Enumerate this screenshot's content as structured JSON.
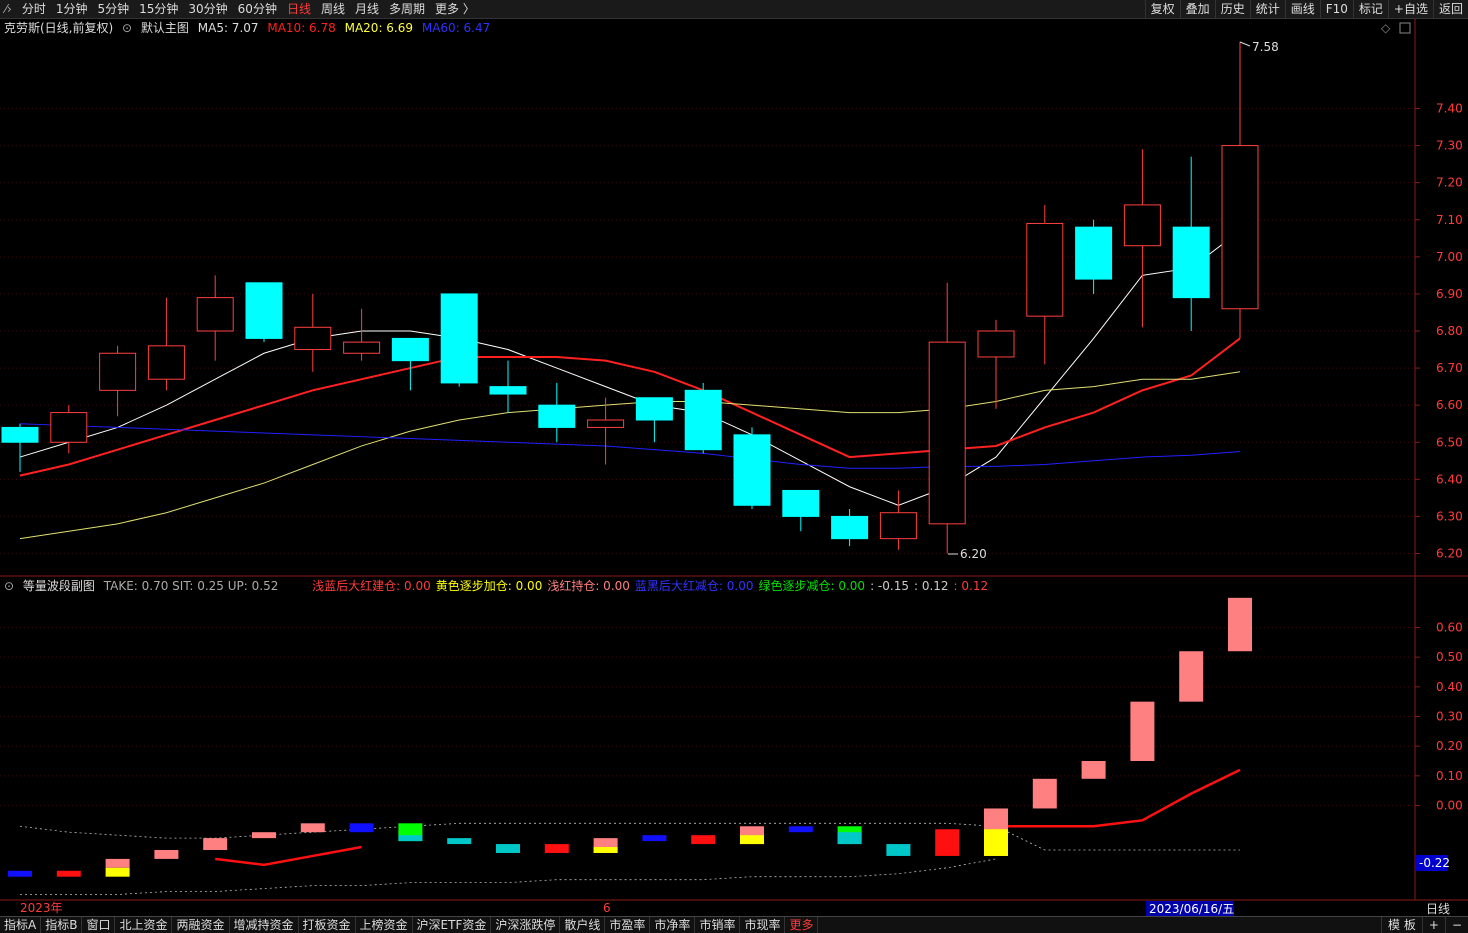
{
  "topbar": {
    "tabs": [
      {
        "label": "分时",
        "active": false
      },
      {
        "label": "1分钟",
        "active": false
      },
      {
        "label": "5分钟",
        "active": false
      },
      {
        "label": "15分钟",
        "active": false
      },
      {
        "label": "30分钟",
        "active": false
      },
      {
        "label": "60分钟",
        "active": false
      },
      {
        "label": "日线",
        "active": true
      },
      {
        "label": "周线",
        "active": false
      },
      {
        "label": "月线",
        "active": false
      },
      {
        "label": "多周期",
        "active": false
      },
      {
        "label": "更多 〉",
        "active": false
      }
    ],
    "right": [
      "复权",
      "叠加",
      "历史",
      "统计",
      "画线",
      "F10",
      "标记",
      "+自选",
      "返回"
    ]
  },
  "main_legend": {
    "stock": "克劳斯(日线,前复权)",
    "template": "默认主图",
    "ma5": "MA5: 7.07",
    "ma10": "MA10: 6.78",
    "ma20": "MA20: 6.69",
    "ma60": "MA60: 6.47"
  },
  "sub_legend": {
    "name": "等量波段副图",
    "params": "TAKE: 0.70  SIT: 0.25  UP: 0.52",
    "items": [
      {
        "text": "浅蓝后大红建仓: 0.00",
        "color": "#ff3b3b"
      },
      {
        "text": "黄色逐步加仓: 0.00",
        "color": "#ffff00"
      },
      {
        "text": "浅红持仓: 0.00",
        "color": "#ff8080"
      },
      {
        "text": "蓝黑后大红减仓: 0.00",
        "color": "#3333ff"
      },
      {
        "text": "绿色逐步减仓: 0.00",
        "color": "#00e000"
      },
      {
        "text": ": -0.15",
        "color": "#cccccc"
      },
      {
        "text": ": 0.12",
        "color": "#cccccc"
      },
      {
        "text": ": 0.12",
        "color": "#ff3b3b"
      }
    ]
  },
  "axis": {
    "price_ticks": [
      "7.40",
      "7.30",
      "7.20",
      "7.10",
      "7.00",
      "6.90",
      "6.80",
      "6.70",
      "6.60",
      "6.50",
      "6.40",
      "6.30",
      "6.20"
    ],
    "sub_ticks": [
      "0.60",
      "0.50",
      "0.40",
      "0.30",
      "0.20",
      "0.10",
      "0.00"
    ],
    "sub_current": "-0.22",
    "high_label": "7.58",
    "low_label": "6.20",
    "date_start": "2023年",
    "date_mid": "6",
    "cursor_date": "2023/06/16/五",
    "period": "日线"
  },
  "colors": {
    "up": "#ff4040",
    "down": "#00ffff",
    "ma5": "#ffffff",
    "ma10": "#ff2020",
    "ma20": "#e0e070",
    "ma60": "#2020ff"
  },
  "chart_data": {
    "type": "candlestick",
    "title": "克劳斯(日线,前复权)",
    "candles": [
      {
        "o": 6.54,
        "h": 6.55,
        "l": 6.42,
        "c": 6.5
      },
      {
        "o": 6.5,
        "h": 6.6,
        "l": 6.47,
        "c": 6.58
      },
      {
        "o": 6.64,
        "h": 6.76,
        "l": 6.57,
        "c": 6.74
      },
      {
        "o": 6.67,
        "h": 6.89,
        "l": 6.64,
        "c": 6.76
      },
      {
        "o": 6.8,
        "h": 6.95,
        "l": 6.72,
        "c": 6.89
      },
      {
        "o": 6.93,
        "h": 6.93,
        "l": 6.77,
        "c": 6.78
      },
      {
        "o": 6.75,
        "h": 6.9,
        "l": 6.69,
        "c": 6.81
      },
      {
        "o": 6.74,
        "h": 6.86,
        "l": 6.72,
        "c": 6.77
      },
      {
        "o": 6.78,
        "h": 6.78,
        "l": 6.64,
        "c": 6.72
      },
      {
        "o": 6.9,
        "h": 6.9,
        "l": 6.65,
        "c": 6.66
      },
      {
        "o": 6.65,
        "h": 6.72,
        "l": 6.58,
        "c": 6.63
      },
      {
        "o": 6.6,
        "h": 6.66,
        "l": 6.5,
        "c": 6.54
      },
      {
        "o": 6.54,
        "h": 6.62,
        "l": 6.44,
        "c": 6.56
      },
      {
        "o": 6.62,
        "h": 6.62,
        "l": 6.5,
        "c": 6.56
      },
      {
        "o": 6.64,
        "h": 6.66,
        "l": 6.47,
        "c": 6.48
      },
      {
        "o": 6.52,
        "h": 6.54,
        "l": 6.32,
        "c": 6.33
      },
      {
        "o": 6.37,
        "h": 6.37,
        "l": 6.26,
        "c": 6.3
      },
      {
        "o": 6.3,
        "h": 6.32,
        "l": 6.22,
        "c": 6.24
      },
      {
        "o": 6.24,
        "h": 6.37,
        "l": 6.21,
        "c": 6.31
      },
      {
        "o": 6.28,
        "h": 6.93,
        "l": 6.2,
        "c": 6.77
      },
      {
        "o": 6.73,
        "h": 6.83,
        "l": 6.59,
        "c": 6.8
      },
      {
        "o": 6.84,
        "h": 7.14,
        "l": 6.71,
        "c": 7.09
      },
      {
        "o": 7.08,
        "h": 7.1,
        "l": 6.9,
        "c": 6.94
      },
      {
        "o": 7.03,
        "h": 7.29,
        "l": 6.81,
        "c": 7.14
      },
      {
        "o": 7.08,
        "h": 7.27,
        "l": 6.8,
        "c": 6.89
      },
      {
        "o": 6.86,
        "h": 7.58,
        "l": 6.78,
        "c": 7.3
      }
    ],
    "ma": {
      "MA5": [
        6.46,
        6.5,
        6.54,
        6.6,
        6.67,
        6.74,
        6.78,
        6.8,
        6.8,
        6.78,
        6.75,
        6.7,
        6.65,
        6.6,
        6.58,
        6.52,
        6.45,
        6.38,
        6.33,
        6.38,
        6.46,
        6.62,
        6.78,
        6.95,
        6.97,
        7.07
      ],
      "MA10": [
        6.41,
        6.44,
        6.48,
        6.52,
        6.56,
        6.6,
        6.64,
        6.67,
        6.7,
        6.73,
        6.73,
        6.73,
        6.72,
        6.69,
        6.64,
        6.58,
        6.52,
        6.46,
        6.47,
        6.48,
        6.49,
        6.54,
        6.58,
        6.64,
        6.68,
        6.78
      ],
      "MA20": [
        6.24,
        6.26,
        6.28,
        6.31,
        6.35,
        6.39,
        6.44,
        6.49,
        6.53,
        6.56,
        6.58,
        6.59,
        6.6,
        6.61,
        6.61,
        6.6,
        6.59,
        6.58,
        6.58,
        6.59,
        6.61,
        6.64,
        6.65,
        6.67,
        6.67,
        6.69
      ],
      "MA60": [
        6.55,
        6.545,
        6.54,
        6.535,
        6.53,
        6.525,
        6.52,
        6.515,
        6.51,
        6.505,
        6.5,
        6.495,
        6.49,
        6.48,
        6.47,
        6.455,
        6.44,
        6.43,
        6.43,
        6.435,
        6.435,
        6.44,
        6.45,
        6.46,
        6.465,
        6.475
      ]
    },
    "sub_bars": [
      {
        "top": -0.22,
        "bot": -0.24,
        "color": "#1010ff"
      },
      {
        "top": -0.22,
        "bot": -0.24,
        "color": "#ff1010"
      },
      {
        "top": -0.18,
        "bot": -0.21,
        "color": "#ff8080",
        "yellow": [
          -0.21,
          -0.24
        ]
      },
      {
        "top": -0.15,
        "bot": -0.18,
        "color": "#ff8080"
      },
      {
        "top": -0.11,
        "bot": -0.15,
        "color": "#ff8080"
      },
      {
        "top": -0.09,
        "bot": -0.11,
        "color": "#ff8080"
      },
      {
        "top": -0.06,
        "bot": -0.09,
        "color": "#ff8080"
      },
      {
        "top": -0.06,
        "bot": -0.09,
        "color": "#1010ff"
      },
      {
        "top": -0.06,
        "bot": -0.12,
        "color": "#00ff00",
        "cyan": [
          -0.1,
          -0.12
        ]
      },
      {
        "top": -0.11,
        "bot": -0.13,
        "color": "#00c8c8"
      },
      {
        "top": -0.13,
        "bot": -0.16,
        "color": "#00c8c8"
      },
      {
        "top": -0.13,
        "bot": -0.16,
        "color": "#ff1010"
      },
      {
        "top": -0.11,
        "bot": -0.16,
        "color": "#ff8080",
        "yellow": [
          -0.14,
          -0.16
        ]
      },
      {
        "top": -0.1,
        "bot": -0.12,
        "color": "#1010ff"
      },
      {
        "top": -0.1,
        "bot": -0.13,
        "color": "#ff1010"
      },
      {
        "top": -0.07,
        "bot": -0.13,
        "color": "#ff8080",
        "yellow": [
          -0.1,
          -0.13
        ]
      },
      {
        "top": -0.07,
        "bot": -0.09,
        "color": "#1010ff"
      },
      {
        "top": -0.07,
        "bot": -0.13,
        "color": "#00ff00",
        "cyan": [
          -0.09,
          -0.13
        ]
      },
      {
        "top": -0.13,
        "bot": -0.17,
        "color": "#00c8c8"
      },
      {
        "top": -0.08,
        "bot": -0.17,
        "color": "#ff1010"
      },
      {
        "top": -0.01,
        "bot": -0.17,
        "color": "#ff8080",
        "yellow": [
          -0.08,
          -0.17
        ]
      },
      {
        "top": 0.09,
        "bot": -0.01,
        "color": "#ff8080"
      },
      {
        "top": 0.15,
        "bot": 0.09,
        "color": "#ff8080"
      },
      {
        "top": 0.35,
        "bot": 0.15,
        "color": "#ff8080"
      },
      {
        "top": 0.52,
        "bot": 0.35,
        "color": "#ff8080"
      },
      {
        "top": 0.7,
        "bot": 0.52,
        "color": "#ff8080"
      }
    ],
    "sub_red_line": [
      null,
      null,
      null,
      null,
      -0.18,
      -0.2,
      -0.17,
      -0.14,
      null,
      null,
      null,
      null,
      null,
      null,
      null,
      null,
      null,
      null,
      null,
      null,
      -0.07,
      -0.07,
      -0.07,
      -0.05,
      0.04,
      0.12
    ],
    "sub_upper_dotted": [
      -0.07,
      -0.09,
      -0.1,
      -0.11,
      -0.11,
      -0.1,
      -0.09,
      -0.08,
      -0.07,
      -0.06,
      -0.06,
      -0.06,
      -0.06,
      -0.06,
      -0.06,
      -0.06,
      -0.06,
      -0.06,
      -0.06,
      -0.06,
      -0.07,
      -0.15,
      -0.15,
      -0.15,
      -0.15,
      -0.15
    ],
    "sub_lower_dotted": [
      -0.3,
      -0.3,
      -0.3,
      -0.29,
      -0.29,
      -0.28,
      -0.27,
      -0.27,
      -0.26,
      -0.26,
      -0.26,
      -0.25,
      -0.25,
      -0.25,
      -0.25,
      -0.24,
      -0.24,
      -0.24,
      -0.23,
      -0.21,
      -0.18,
      null,
      null,
      null,
      null,
      null
    ]
  }
}
